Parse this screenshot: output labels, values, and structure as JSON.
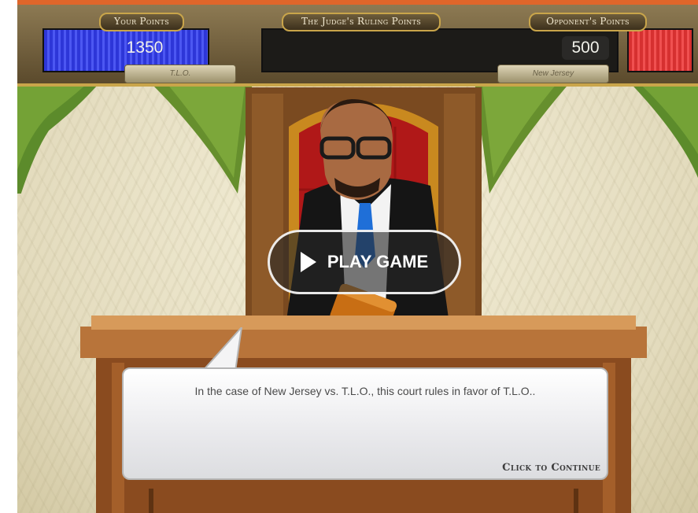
{
  "scoreboard": {
    "your_points_label": "Your Points",
    "judge_label": "The Judge's Ruling Points",
    "opponent_points_label": "Opponent's Points",
    "your_score": "1350",
    "opponent_score": "500",
    "your_name": "T.L.O.",
    "opponent_name": "New Jersey",
    "colors": {
      "player": "#2d36d8",
      "opponent": "#d63030"
    }
  },
  "play_button": {
    "label": "PLAY GAME",
    "icon": "play-icon"
  },
  "dialog": {
    "text": "In the case of New Jersey vs. T.L.O., this court rules in favor of T.L.O..",
    "continue_label": "Click to Continue"
  },
  "accent_color": "#e0662a"
}
